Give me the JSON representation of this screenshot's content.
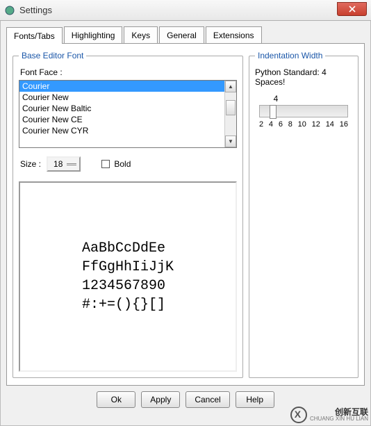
{
  "window": {
    "title": "Settings"
  },
  "tabs": {
    "items": [
      {
        "label": "Fonts/Tabs"
      },
      {
        "label": "Highlighting"
      },
      {
        "label": "Keys"
      },
      {
        "label": "General"
      },
      {
        "label": "Extensions"
      }
    ],
    "active": 0
  },
  "base_font": {
    "legend": "Base Editor Font",
    "face_label": "Font Face :",
    "list": [
      "Courier",
      "Courier New",
      "Courier New Baltic",
      "Courier New CE",
      "Courier New CYR"
    ],
    "selected_index": 0,
    "size_label": "Size :",
    "size_value": "18",
    "bold_label": "Bold",
    "bold_checked": false,
    "preview": "AaBbCcDdEe\nFfGgHhIiJjK\n1234567890\n#:+=(){}[]"
  },
  "indent": {
    "legend": "Indentation Width",
    "standard": "Python Standard: 4 Spaces!",
    "value": "4",
    "ticks": [
      "2",
      "4",
      "6",
      "8",
      "10",
      "12",
      "14",
      "16"
    ]
  },
  "buttons": {
    "ok": "Ok",
    "apply": "Apply",
    "cancel": "Cancel",
    "help": "Help"
  },
  "watermark": {
    "brand": "创新互联",
    "sub": "CHUANG XIN HU LIAN"
  }
}
